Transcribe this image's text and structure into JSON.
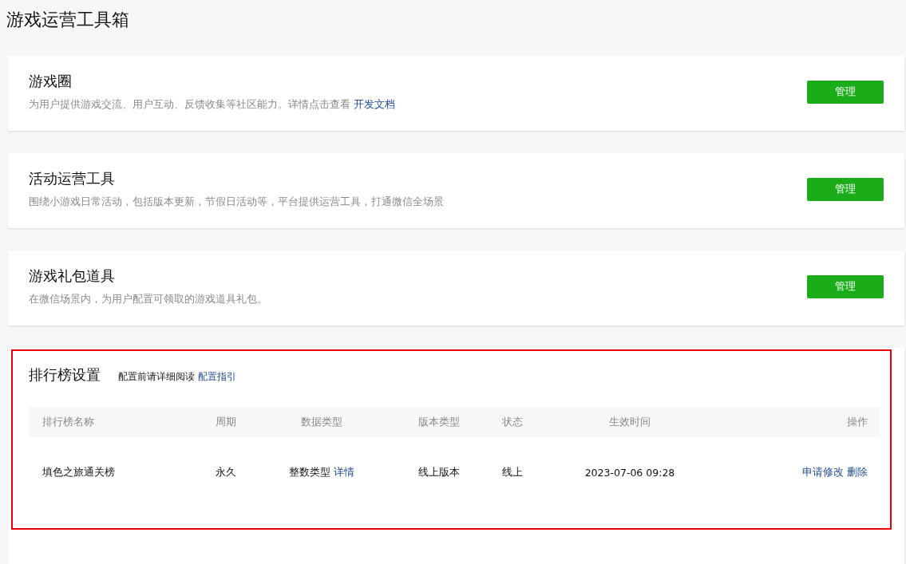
{
  "page_title": "游戏运营工具箱",
  "tools": [
    {
      "title": "游戏圈",
      "description": "为用户提供游戏交流、用户互动、反馈收集等社区能力。详情点击查看",
      "link": "开发文档",
      "button": "管理"
    },
    {
      "title": "活动运营工具",
      "description": "围绕小游戏日常活动，包括版本更新，节假日活动等，平台提供运营工具，打通微信全场景",
      "button": "管理"
    },
    {
      "title": "游戏礼包道具",
      "description": "在微信场景内，为用户配置可领取的游戏道具礼包。",
      "button": "管理"
    }
  ],
  "leaderboard": {
    "title": "排行榜设置",
    "hint": "配置前请详细阅读",
    "hint_link": "配置指引",
    "columns": [
      "排行榜名称",
      "周期",
      "数据类型",
      "版本类型",
      "状态",
      "生效时间",
      "操作"
    ],
    "rows": [
      {
        "name": "填色之旅通关榜",
        "period": "永久",
        "data_type": "整数类型",
        "data_type_link": "详情",
        "version": "线上版本",
        "status": "线上",
        "effective_time": "2023-07-06 09:28",
        "actions": [
          "申请修改",
          "删除"
        ]
      }
    ]
  }
}
